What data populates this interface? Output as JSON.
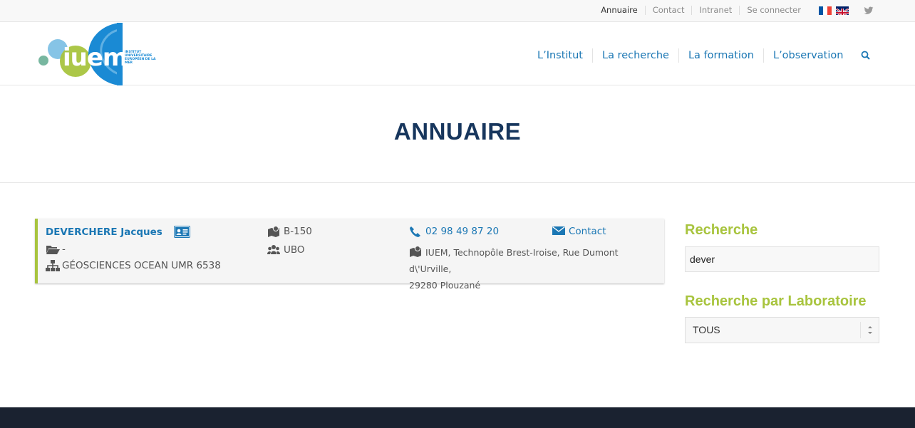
{
  "topbar": {
    "links": [
      {
        "label": "Annuaire"
      },
      {
        "label": "Contact"
      },
      {
        "label": "Intranet"
      },
      {
        "label": "Se connecter"
      }
    ]
  },
  "logo": {
    "text": "iuem",
    "subtitle": "INSTITUT UNIVERSITAIRE EUROPÉEN DE LA MER"
  },
  "nav": {
    "items": [
      {
        "label": "L’Institut"
      },
      {
        "label": "La recherche"
      },
      {
        "label": "La formation"
      },
      {
        "label": "L’observation"
      }
    ]
  },
  "page": {
    "title": "ANNUAIRE"
  },
  "result": {
    "name": "DEVERCHERE Jacques",
    "folder": "-",
    "lab": "GÉOSCIENCES OCEAN UMR 6538",
    "office": "B-150",
    "institution": "UBO",
    "phone": "02 98 49 87 20",
    "address_line1": "IUEM, Technopôle Brest-Iroise, Rue Dumont d\\'Urville,",
    "address_line2": "29280 Plouzané",
    "contact_label": "Contact"
  },
  "sidebar": {
    "search_heading": "Recherche",
    "search_value": "dever",
    "lab_heading": "Recherche par Laboratoire",
    "lab_selected": "TOUS"
  },
  "colors": {
    "accent_green": "#a8c43e",
    "link_blue": "#1b77b4",
    "title_navy": "#17365d",
    "footer": "#1a2230"
  }
}
